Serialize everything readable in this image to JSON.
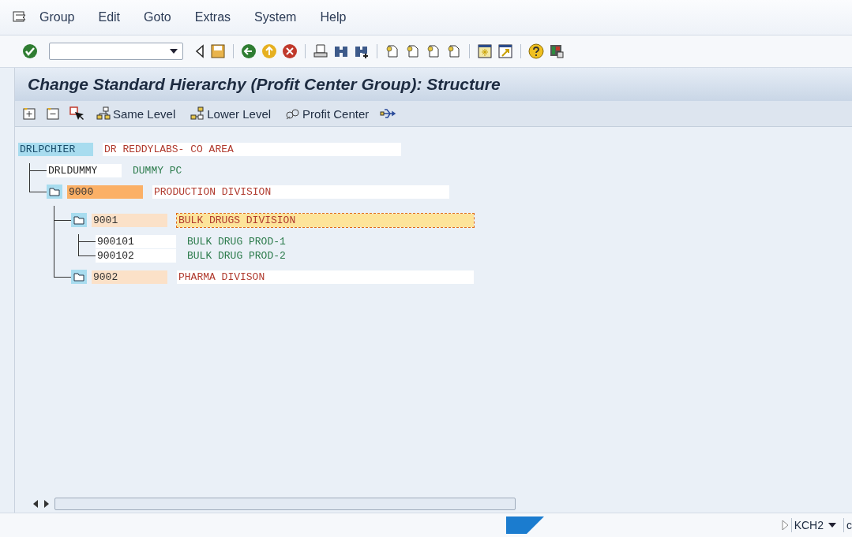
{
  "menu": [
    {
      "label": "Group"
    },
    {
      "label": "Edit"
    },
    {
      "label": "Goto"
    },
    {
      "label": "Extras"
    },
    {
      "label": "System"
    },
    {
      "label": "Help"
    }
  ],
  "title": "Change Standard Hierarchy (Profit Center Group): Structure",
  "app_toolbar": [
    {
      "label": "Same Level"
    },
    {
      "label": "Lower Level"
    },
    {
      "label": "Profit Center"
    }
  ],
  "tree": [
    {
      "kind": "root",
      "code": "DRLPCHIER",
      "description": "DR REDDYLABS- CO AREA",
      "selected": false,
      "focused": false,
      "children": [
        {
          "kind": "profit_center",
          "code": "DRLDUMMY",
          "description": "DUMMY PC",
          "selected": false,
          "focused": false
        },
        {
          "kind": "group",
          "code": "9000",
          "description": "PRODUCTION DIVISION",
          "selected": true,
          "focused": false,
          "children": [
            {
              "kind": "group",
              "code": "9001",
              "description": "BULK DRUGS DIVISION",
              "selected": false,
              "focused": true,
              "children": [
                {
                  "kind": "profit_center",
                  "code": "900101",
                  "description": "BULK DRUG PROD-1",
                  "selected": false,
                  "focused": false
                },
                {
                  "kind": "profit_center",
                  "code": "900102",
                  "description": "BULK DRUG PROD-2",
                  "selected": false,
                  "focused": false
                }
              ]
            },
            {
              "kind": "group",
              "code": "9002",
              "description": "PHARMA DIVISON",
              "selected": false,
              "focused": false
            }
          ]
        }
      ]
    }
  ],
  "status_bar": {
    "system": "KCH2",
    "client": "c"
  }
}
